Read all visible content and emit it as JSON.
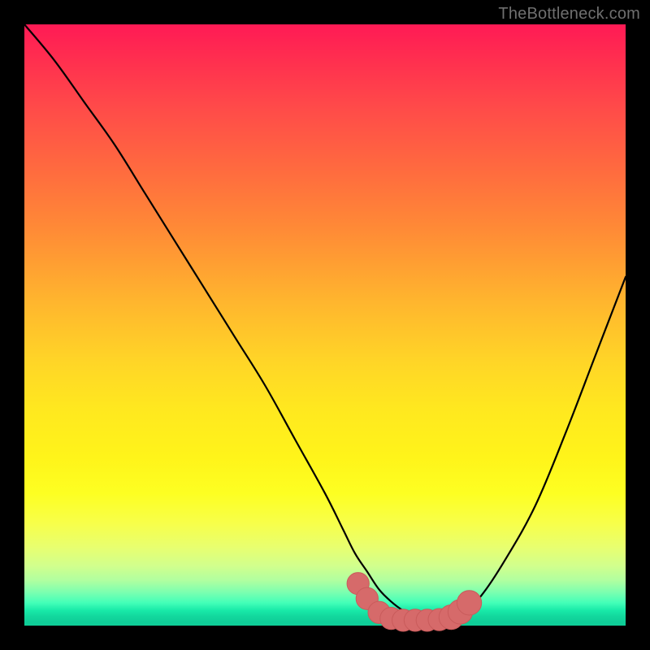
{
  "watermark": "TheBottleneck.com",
  "colors": {
    "background": "#000000",
    "curve_stroke": "#000000",
    "marker_fill": "#d66a6a",
    "marker_stroke": "#c95b5b"
  },
  "chart_data": {
    "type": "line",
    "title": "",
    "xlabel": "",
    "ylabel": "",
    "xlim": [
      0,
      100
    ],
    "ylim": [
      0,
      100
    ],
    "grid": false,
    "legend": false,
    "series": [
      {
        "name": "bottleneck-curve",
        "x": [
          0,
          5,
          10,
          15,
          20,
          25,
          30,
          35,
          40,
          45,
          50,
          53,
          55,
          57,
          59,
          61,
          63,
          65,
          67,
          69,
          71,
          73,
          76,
          80,
          85,
          90,
          95,
          100
        ],
        "y": [
          100,
          94,
          87,
          80,
          72,
          64,
          56,
          48,
          40,
          31,
          22,
          16,
          12,
          9,
          6,
          4,
          2.5,
          1.5,
          1,
          1,
          1.4,
          2.3,
          5,
          11,
          20,
          32,
          45,
          58
        ]
      }
    ],
    "markers": [
      {
        "x": 55.5,
        "y": 7.0,
        "r": 1.3
      },
      {
        "x": 57.0,
        "y": 4.5,
        "r": 1.3
      },
      {
        "x": 59.0,
        "y": 2.2,
        "r": 1.3
      },
      {
        "x": 61.0,
        "y": 1.2,
        "r": 1.3
      },
      {
        "x": 63.0,
        "y": 0.9,
        "r": 1.3
      },
      {
        "x": 65.0,
        "y": 0.9,
        "r": 1.3
      },
      {
        "x": 67.0,
        "y": 0.9,
        "r": 1.3
      },
      {
        "x": 69.0,
        "y": 1.0,
        "r": 1.3
      },
      {
        "x": 71.0,
        "y": 1.4,
        "r": 1.5
      },
      {
        "x": 72.5,
        "y": 2.3,
        "r": 1.5
      },
      {
        "x": 74.0,
        "y": 3.8,
        "r": 1.5
      }
    ]
  }
}
